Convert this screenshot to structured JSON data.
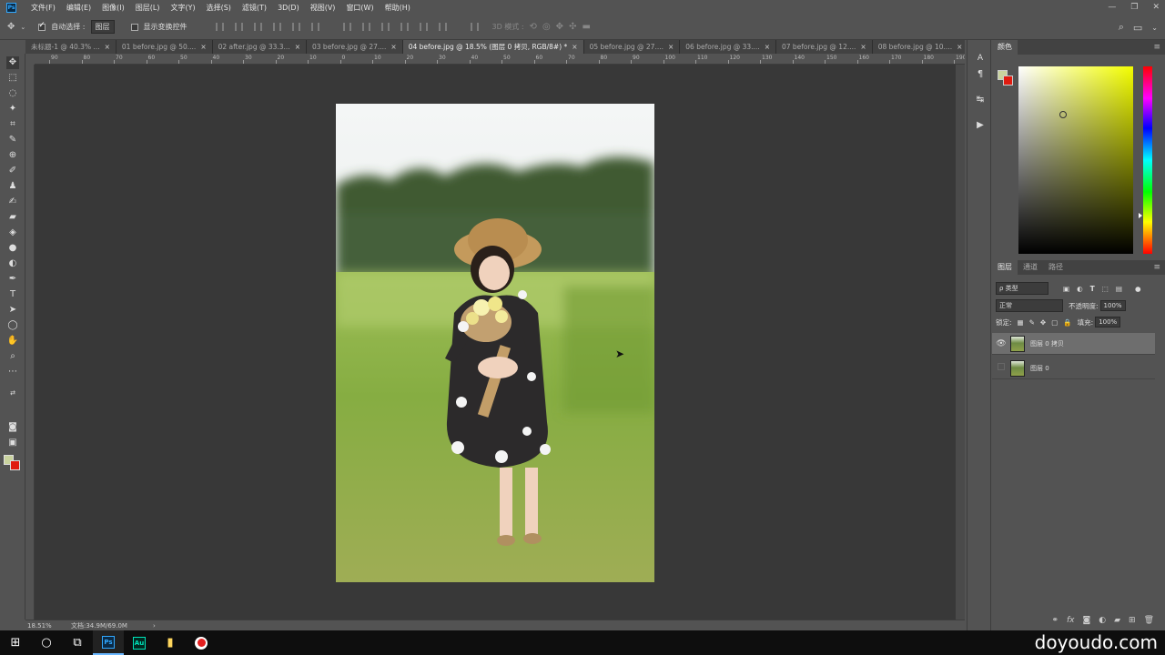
{
  "menubar": {
    "items": [
      "文件(F)",
      "编辑(E)",
      "图像(I)",
      "图层(L)",
      "文字(Y)",
      "选择(S)",
      "滤镜(T)",
      "3D(D)",
      "视图(V)",
      "窗口(W)",
      "帮助(H)"
    ],
    "window_controls": [
      "—",
      "❐",
      "✕"
    ]
  },
  "options": {
    "auto_select_label": "自动选择 :",
    "auto_select_value": "图层",
    "show_transform_label": "显示变换控件",
    "mode_3d_label": "3D 模式 :"
  },
  "tabs": [
    "未标题-1 @ 40.3% ...",
    "01 before.jpg @ 50....",
    "02 after.jpg @ 33.3...",
    "03 before.jpg @ 27....",
    "04 before.jpg @ 18.5% (图层 0 拷贝, RGB/8#) *",
    "05 before.jpg @ 27....",
    "06 before.jpg @ 33....",
    "07 before.jpg @ 12....",
    "08 before.jpg @ 10...."
  ],
  "ruler": {
    "labels": [
      "90",
      "80",
      "70",
      "60",
      "50",
      "40",
      "30",
      "20",
      "10",
      "0",
      "10",
      "20",
      "30",
      "40",
      "50",
      "60",
      "70",
      "80",
      "90",
      "100",
      "110",
      "120",
      "130",
      "140",
      "150",
      "160",
      "170",
      "180",
      "190"
    ]
  },
  "status": {
    "zoom": "18.51%",
    "doc": "文档:34.9M/69.0M",
    "arrow": "›"
  },
  "color_panel": {
    "tab": "颜色",
    "menu": "≡",
    "fg_color": "#c9d39e",
    "bg_color": "#e01b10"
  },
  "layers_panel": {
    "tabs": [
      "图层",
      "通道",
      "路径"
    ],
    "menu": "≡",
    "filter_label": "ρ 类型",
    "blend_mode": "正常",
    "opacity_label": "不透明度:",
    "opacity_value": "100%",
    "lock_label": "锁定:",
    "fill_label": "填充:",
    "fill_value": "100%",
    "layers": [
      {
        "name": "图层 0 拷贝",
        "visible": true,
        "selected": true
      },
      {
        "name": "图层 0",
        "visible": false,
        "selected": false
      }
    ],
    "bottom_icons": [
      "link-icon",
      "fx-icon",
      "mask-icon",
      "adjustment-icon",
      "group-icon",
      "new-layer-icon",
      "trash-icon"
    ]
  },
  "taskbar": {
    "watermark": "doyoudo.com",
    "ps_label": "Ps",
    "au_label": "Au"
  }
}
